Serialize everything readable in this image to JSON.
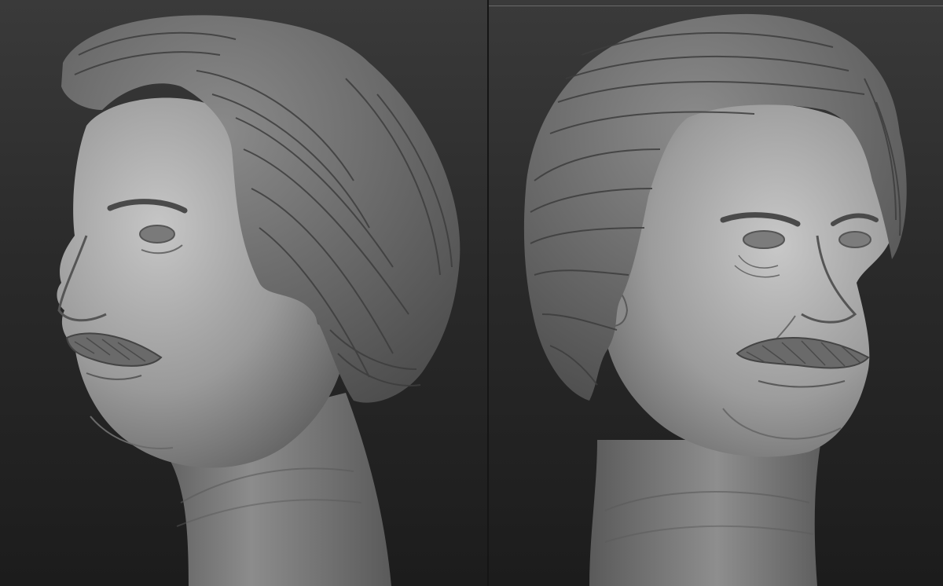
{
  "scene": {
    "views": [
      {
        "id": "left",
        "orientation": "profile-facing-left"
      },
      {
        "id": "right",
        "orientation": "three-quarter-facing-right"
      }
    ],
    "colors": {
      "background_top": "#3a3a3a",
      "background_bottom": "#1c1c1c",
      "clay_light": "#c4c4c4",
      "clay_mid": "#8e8e8e",
      "clay_dark": "#4a4a4a",
      "hair": "#6f6f6f"
    }
  }
}
